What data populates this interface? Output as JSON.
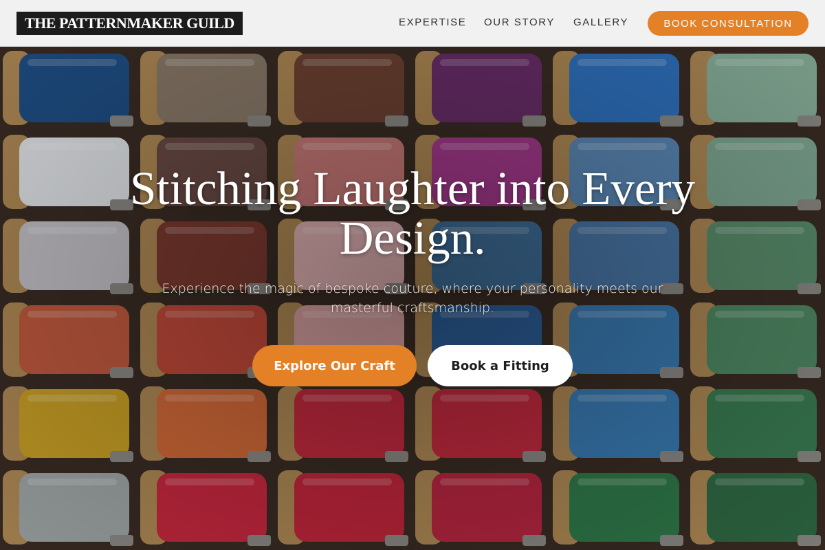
{
  "header": {
    "logo": "THE PATTERNMAKER GUILD",
    "nav": [
      {
        "label": "EXPERTISE"
      },
      {
        "label": "OUR STORY"
      },
      {
        "label": "GALLERY"
      }
    ],
    "cta_label": "BOOK CONSULTATION"
  },
  "hero": {
    "headline": "Stitching Laughter into Every Design.",
    "subtitle": "Experience the magic of bespoke couture, where your personality meets our masterful craftsmanship.",
    "primary_button": "Explore Our Craft",
    "secondary_button": "Book a Fitting",
    "background_image": "colorful thread spools rack"
  },
  "colors": {
    "accent": "#e48127",
    "header_bg": "#f1f1f1",
    "logo_bg": "#1c1c1c",
    "headline": "#ffffff"
  },
  "spool_columns": [
    [
      "#1f4f86",
      "#e3e6ea",
      "#c4c2c7",
      "#c25a3f",
      "#c9a025",
      "#9fa5a6"
    ],
    [
      "#8a7a6a",
      "#6a4a45",
      "#7d3a30",
      "#c44a3a",
      "#d36a38",
      "#c8283f"
    ],
    [
      "#6f4233",
      "#c97a78",
      "#e3b3b5",
      "#d9a2a2",
      "#c42a3f",
      "#c2263c"
    ],
    [
      "#6a2e6a",
      "#a63a8e",
      "#3f6f9a",
      "#2d5f9a",
      "#c42a3f",
      "#b82640"
    ],
    [
      "#2f72c0",
      "#5b89b7",
      "#4a78a8",
      "#3a7cb5",
      "#3a7cb5",
      "#2f7a4a"
    ],
    [
      "#88b09a",
      "#7fa892",
      "#5a8e6c",
      "#4f8a64",
      "#3a7c52",
      "#2f6a44"
    ]
  ]
}
